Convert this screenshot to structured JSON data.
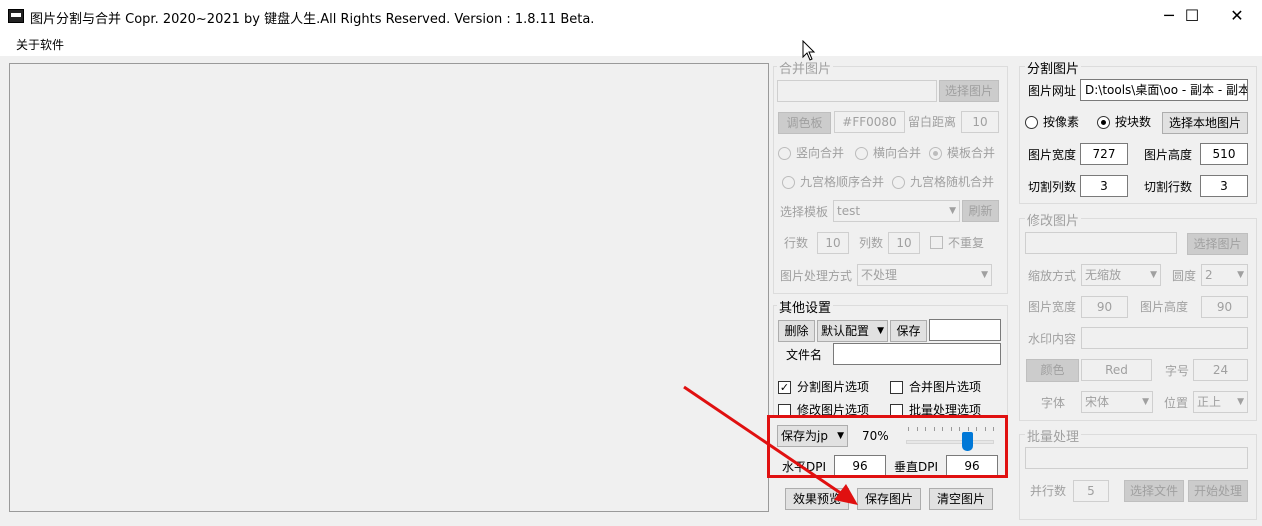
{
  "window": {
    "title": "图片分割与合并    Copr. 2020~2021 by 键盘人生.All Rights Reserved.  Version : 1.8.11 Beta.",
    "controls": {
      "minimize": "─",
      "maximize": "☐",
      "close": "✕"
    }
  },
  "menu": {
    "about": "关于软件"
  },
  "merge": {
    "title": "合并图片",
    "select_image": "选择图片",
    "palette": "调色板",
    "color_value": "#FF0080",
    "margin_label": "留白距离",
    "margin_value": "10",
    "vertical": "竖向合并",
    "horizontal": "横向合并",
    "template": "模板合并",
    "grid_order": "九宫格顺序合并",
    "grid_random": "九宫格随机合并",
    "template_label": "选择模板",
    "template_value": "test",
    "refresh": "刷新",
    "rows_label": "行数",
    "rows_value": "10",
    "cols_label": "列数",
    "cols_value": "10",
    "no_repeat": "不重复",
    "process_label": "图片处理方式",
    "process_value": "不处理"
  },
  "other": {
    "title": "其他设置",
    "delete": "删除",
    "config": "默认配置",
    "save": "保存",
    "filename_label": "文件名",
    "opt_split": "分割图片选项",
    "opt_merge": "合并图片选项",
    "opt_modify": "修改图片选项",
    "opt_batch": "批量处理选项",
    "format": "保存为jp",
    "quality": "70%",
    "hdpi_label": "水平DPI",
    "hdpi_value": "96",
    "vdpi_label": "垂直DPI",
    "vdpi_value": "96",
    "preview": "效果预览",
    "save_image": "保存图片",
    "clear_image": "清空图片"
  },
  "split": {
    "title": "分割图片",
    "url_label": "图片网址",
    "url_value": "D:\\tools\\桌面\\oo - 副本 - 副本",
    "by_pixel": "按像素",
    "by_block": "按块数",
    "select_local": "选择本地图片",
    "width_label": "图片宽度",
    "width_value": "727",
    "height_label": "图片高度",
    "height_value": "510",
    "cols_label": "切割列数",
    "cols_value": "3",
    "rows_label": "切割行数",
    "rows_value": "3"
  },
  "modify": {
    "title": "修改图片",
    "select_image": "选择图片",
    "scale_label": "缩放方式",
    "scale_value": "无缩放",
    "angle_label": "圆度",
    "angle_value": "2",
    "width_label": "图片宽度",
    "width_value": "90",
    "height_label": "图片高度",
    "height_value": "90",
    "watermark_label": "水印内容",
    "color_btn": "颜色",
    "color_value": "Red",
    "fontsize_label": "字号",
    "fontsize_value": "24",
    "font_label": "字体",
    "font_value": "宋体",
    "pos_label": "位置",
    "pos_value": "正上"
  },
  "batch": {
    "title": "批量处理",
    "parallel_label": "并行数",
    "parallel_value": "5",
    "select_btn": "选择文件",
    "start_btn": "开始处理"
  },
  "quality_level": 0.7,
  "colors": {
    "accent": "#0078d7",
    "annotation": "#e01010"
  }
}
